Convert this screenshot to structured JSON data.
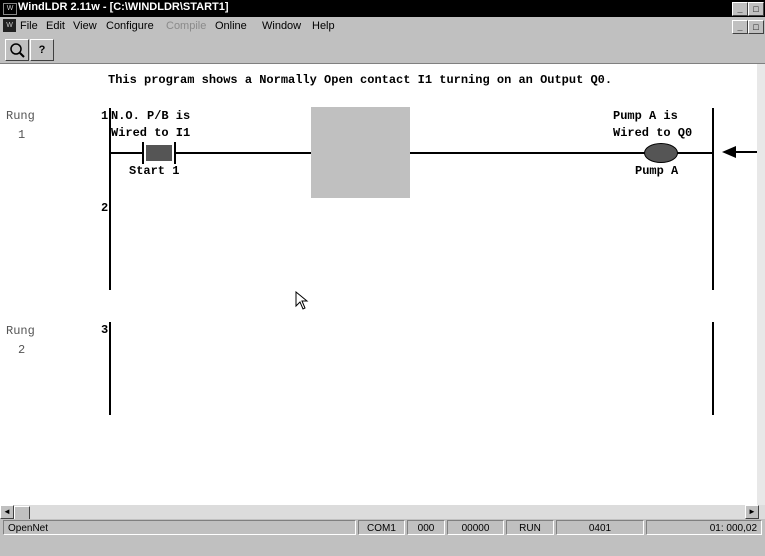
{
  "window": {
    "title": "WindLDR 2.11w - [C:\\WINDLDR\\START1]",
    "app_icon_text": "W",
    "minimize_glyph": "_",
    "restore_glyph": "□",
    "close_glyph": "×"
  },
  "menu": {
    "items": [
      "File",
      "Edit",
      "View",
      "Configure",
      "Compile",
      "Online",
      "Window",
      "Help"
    ]
  },
  "toolbar": {
    "zoom_glyph": "⌕",
    "help_glyph": "?"
  },
  "ladder": {
    "comment": "This program shows a Normally Open contact I1 turning on an Output Q0.",
    "rung1_label": "Rung",
    "rung1_number": "1",
    "rung2_label": "Rung",
    "rung2_number": "2",
    "line1": "1",
    "line2": "2",
    "line3": "3",
    "contact_comment_line1": "N.O. P/B is",
    "contact_comment_line2": "Wired to I1",
    "contact_label": "Start 1",
    "coil_comment_line1": "Pump A is",
    "coil_comment_line2": "Wired to Q0",
    "coil_label": "Pump A"
  },
  "scroll": {
    "left_arrow": "◄",
    "right_arrow": "►"
  },
  "status": {
    "network": "OpenNet",
    "port": "COM1",
    "station": "000",
    "address": "00000",
    "mode": "RUN",
    "code": "0401",
    "position": "01: 000,02"
  }
}
